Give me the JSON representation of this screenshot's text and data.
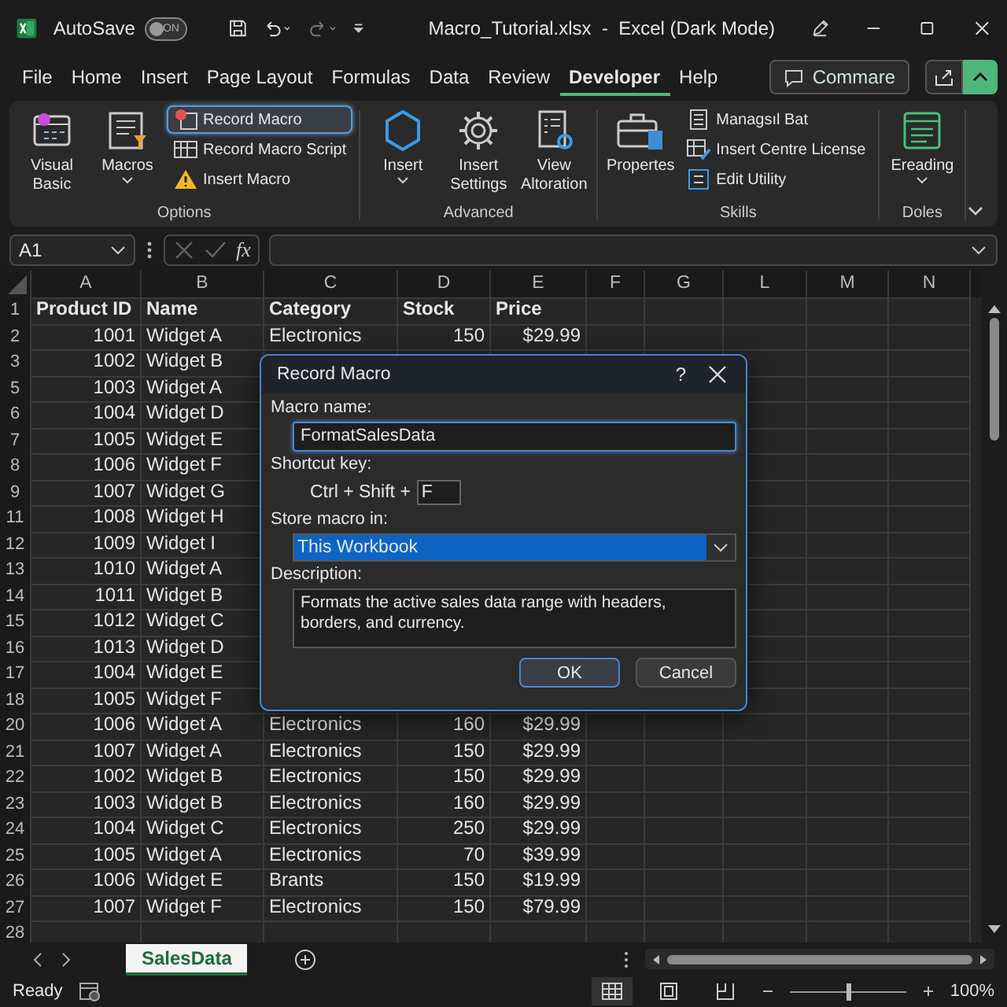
{
  "title_bar": {
    "autosave": {
      "label": "AutoSave",
      "toggle_text": "ON",
      "on": false
    },
    "title": "Macro_Tutorial.xlsx  -  Excel (Dark Mode)"
  },
  "menu": {
    "tabs": [
      {
        "label": "File",
        "selected": false
      },
      {
        "label": "Home",
        "selected": false
      },
      {
        "label": "Insert",
        "selected": false
      },
      {
        "label": "Page Layout",
        "selected": false
      },
      {
        "label": "Formulas",
        "selected": false
      },
      {
        "label": "Data",
        "selected": false
      },
      {
        "label": "Review",
        "selected": false
      },
      {
        "label": "Developer",
        "selected": true
      },
      {
        "label": "Help",
        "selected": false
      }
    ],
    "comments_button": "Commare"
  },
  "ribbon": {
    "groups": [
      {
        "label": "Options",
        "items": [
          {
            "kind": "large",
            "label": "Visual Basic",
            "dropdown": false
          },
          {
            "kind": "large",
            "label": "Macros",
            "dropdown": true
          },
          {
            "kind": "small",
            "label": "Record Macro",
            "highlighted": true
          },
          {
            "kind": "small",
            "label": "Record Macro Script",
            "highlighted": false
          },
          {
            "kind": "small",
            "label": "Insert Macro",
            "highlighted": false
          }
        ]
      },
      {
        "label": "Advanced",
        "items": [
          {
            "kind": "large",
            "label": "Insert",
            "dropdown": true
          },
          {
            "kind": "large",
            "label": "Insert Settings",
            "dropdown": false
          },
          {
            "kind": "large",
            "label": "View Altoration",
            "dropdown": false
          }
        ]
      },
      {
        "label": "Skills",
        "items": [
          {
            "kind": "large",
            "label": "Propertes",
            "dropdown": false
          },
          {
            "kind": "small",
            "label": "Managsıl Bat",
            "highlighted": false
          },
          {
            "kind": "small",
            "label": "Insert Centre License",
            "highlighted": false
          },
          {
            "kind": "small",
            "label": "Edit Utility",
            "highlighted": false
          }
        ]
      },
      {
        "label": "Doles",
        "items": [
          {
            "kind": "large",
            "label": "Ereading",
            "dropdown": true
          }
        ]
      }
    ]
  },
  "formula_bar": {
    "name_box": "A1",
    "fx": "fx"
  },
  "sheet": {
    "columns": [
      "A",
      "B",
      "C",
      "D",
      "E",
      "F",
      "G",
      "L",
      "M",
      "N"
    ],
    "rows": [
      {
        "num": "1",
        "kind": "header",
        "cells": [
          "Product ID",
          "Name",
          "Category",
          "Stock",
          "Price"
        ]
      },
      {
        "num": "2",
        "kind": "data",
        "cells": [
          "1001",
          "Widget A",
          "Electronics",
          "150",
          "$29.99"
        ]
      },
      {
        "num": "3",
        "kind": "data",
        "cells": [
          "1002",
          "Widget B"
        ]
      },
      {
        "num": "5",
        "kind": "data",
        "cells": [
          "1003",
          "Widget A"
        ]
      },
      {
        "num": "6",
        "kind": "data",
        "cells": [
          "1004",
          "Widget D"
        ]
      },
      {
        "num": "7",
        "kind": "data",
        "cells": [
          "1005",
          "Widget E"
        ]
      },
      {
        "num": "8",
        "kind": "data",
        "cells": [
          "1006",
          "Widget F"
        ]
      },
      {
        "num": "9",
        "kind": "data",
        "cells": [
          "1007",
          "Widget G"
        ]
      },
      {
        "num": "11",
        "kind": "data",
        "cells": [
          "1008",
          "Widget H"
        ]
      },
      {
        "num": "12",
        "kind": "data",
        "cells": [
          "1009",
          "Widget I"
        ]
      },
      {
        "num": "13",
        "kind": "data",
        "cells": [
          "1010",
          "Widget A"
        ]
      },
      {
        "num": "14",
        "kind": "data",
        "cells": [
          "1011",
          "Widget B"
        ]
      },
      {
        "num": "15",
        "kind": "data",
        "cells": [
          "1012",
          "Widget C"
        ]
      },
      {
        "num": "16",
        "kind": "data",
        "cells": [
          "1013",
          "Widget D"
        ]
      },
      {
        "num": "17",
        "kind": "data",
        "cells": [
          "1004",
          "Widget E"
        ]
      },
      {
        "num": "18",
        "kind": "data",
        "cells": [
          "1005",
          "Widget F"
        ]
      },
      {
        "num": "20",
        "kind": "data",
        "cells": [
          "1006",
          "Widget A",
          "Electronics",
          "160",
          "$29.99"
        ]
      },
      {
        "num": "21",
        "kind": "data",
        "cells": [
          "1007",
          "Widget A",
          "Electronics",
          "150",
          "$29.99"
        ]
      },
      {
        "num": "22",
        "kind": "data",
        "cells": [
          "1002",
          "Widget B",
          "Electronics",
          "150",
          "$29.99"
        ]
      },
      {
        "num": "23",
        "kind": "data",
        "cells": [
          "1003",
          "Widget B",
          "Electronics",
          "160",
          "$29.99"
        ]
      },
      {
        "num": "24",
        "kind": "data",
        "cells": [
          "1004",
          "Widget C",
          "Electronics",
          "250",
          "$29.99"
        ]
      },
      {
        "num": "25",
        "kind": "data",
        "cells": [
          "1005",
          "Widget A",
          "Electronics",
          "70",
          "$39.99"
        ]
      },
      {
        "num": "26",
        "kind": "data",
        "cells": [
          "1006",
          "Widget E",
          "Brants",
          "150",
          "$19.99"
        ]
      },
      {
        "num": "27",
        "kind": "data",
        "cells": [
          "1007",
          "Widget F",
          "Electronics",
          "150",
          "$79.99"
        ]
      },
      {
        "num": "28",
        "kind": "data"
      }
    ]
  },
  "dialog": {
    "title": "Record Macro",
    "help": "?",
    "macro_name_label": "Macro name:",
    "macro_name": "FormatSalesData",
    "shortcut_label": "Shortcut key:",
    "shortcut_prefix": "Ctrl + Shift +",
    "shortcut_key": "F",
    "store_label": "Store macro in:",
    "store_value": "This Workbook",
    "description_label": "Description:",
    "description": "Formats the active sales data range with headers, borders, and currency.",
    "buttons": [
      {
        "label": "OK",
        "default": true
      },
      {
        "label": "Cancel",
        "default": false
      }
    ]
  },
  "sheet_tabs": [
    {
      "label": "SalesData",
      "selected": true
    }
  ],
  "status_bar": {
    "text": "Ready",
    "views": [
      {
        "selected": true
      },
      {
        "selected": false
      },
      {
        "selected": false
      }
    ],
    "zoom": {
      "level": 0.5,
      "reading": "100%"
    }
  }
}
